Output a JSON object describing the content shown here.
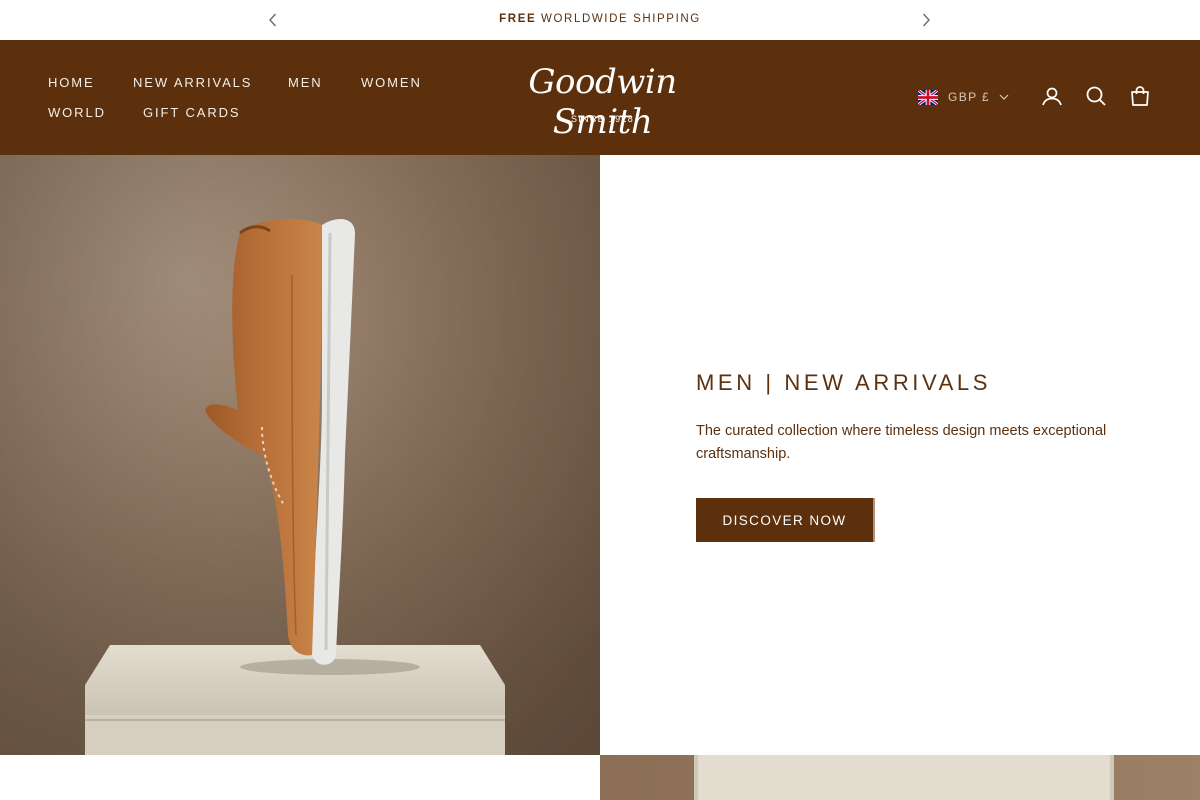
{
  "announcement": {
    "bold": "FREE",
    "text": " WORLDWIDE SHIPPING",
    "prev_icon": "chevron-left-icon",
    "next_icon": "chevron-right-icon"
  },
  "header": {
    "nav": [
      "HOME",
      "NEW ARRIVALS",
      "MEN",
      "WOMEN",
      "WORLD",
      "GIFT CARDS"
    ],
    "logo_script": "Goodwin Smith",
    "logo_since": "SINCE 1928",
    "locale": {
      "flag": "uk-flag-icon",
      "currency": "GBP £"
    },
    "icons": [
      "account-icon",
      "search-icon",
      "cart-bag-icon"
    ]
  },
  "hero": {
    "title": "MEN | NEW ARRIVALS",
    "subtitle": "The curated collection where timeless design meets exceptional craftsmanship.",
    "button": "DISCOVER NOW"
  },
  "colors": {
    "brand_brown": "#5c300c",
    "text_brown": "#5c3110",
    "header_text": "#f4ede6"
  }
}
